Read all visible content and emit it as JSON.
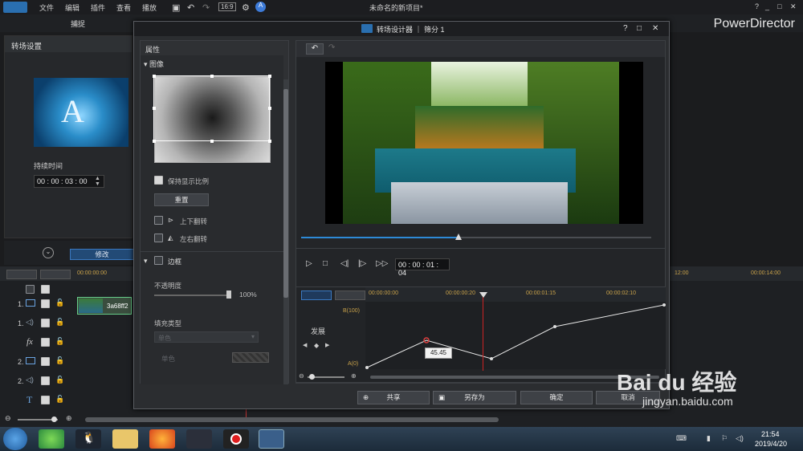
{
  "app": {
    "menu": [
      "文件",
      "编辑",
      "插件",
      "查看",
      "播放"
    ],
    "title": "未命名的新项目*",
    "brand": "PowerDirector",
    "capture_tab": "捕捉",
    "window_controls": [
      "?",
      "_",
      "□",
      "✕"
    ]
  },
  "left_panel": {
    "title": "转场设置",
    "thumb_letter": "A",
    "duration_label": "持续时间",
    "duration_value": "00 : 00 : 03 : 00",
    "modify_button": "修改"
  },
  "dialog": {
    "title": "转场设计器 ｜ 筛分 1",
    "controls": [
      "?",
      "□",
      "✕"
    ],
    "properties_title": "属性",
    "image_section": "图像",
    "keep_ratio_label": "保持显示比例",
    "keep_ratio_checked": true,
    "reset_button": "重置",
    "flip_vertical_label": "上下翻转",
    "flip_horizontal_label": "左右翻转",
    "border_section": "边框",
    "opacity_label": "不透明度",
    "opacity_value": "100%",
    "opacity_level": 1.0,
    "fill_type_label": "填充类型",
    "fill_type_value": "单色",
    "single_color_label": "单色",
    "timecode": "00 : 00 : 01 : 04",
    "playback_progress": 0.45,
    "keyframe": {
      "ruler_labels": [
        "00:00:00:00",
        "00:00:00:20",
        "00:00:01:15",
        "00:00:02:10"
      ],
      "top_label": "B(100)",
      "bottom_label": "A(0)",
      "track_label": "发展",
      "tooltip_value": "45.45"
    },
    "buttons": {
      "share": "共享",
      "save_as": "另存为",
      "ok": "确定",
      "cancel": "取消"
    }
  },
  "timeline": {
    "ruler_left": "00:00:00:00",
    "ruler_right_1": "12:00",
    "ruler_right_2": "00:00:14:00",
    "tracks": [
      "1.",
      "1.",
      "fx",
      "2.",
      "2.",
      "T"
    ],
    "clip_label": "3a68ff2"
  },
  "taskbar": {
    "time": "21:54",
    "date": "2019/4/20"
  },
  "watermark": {
    "text": "Bai du 经验",
    "url": "jingyan.baidu.com"
  }
}
